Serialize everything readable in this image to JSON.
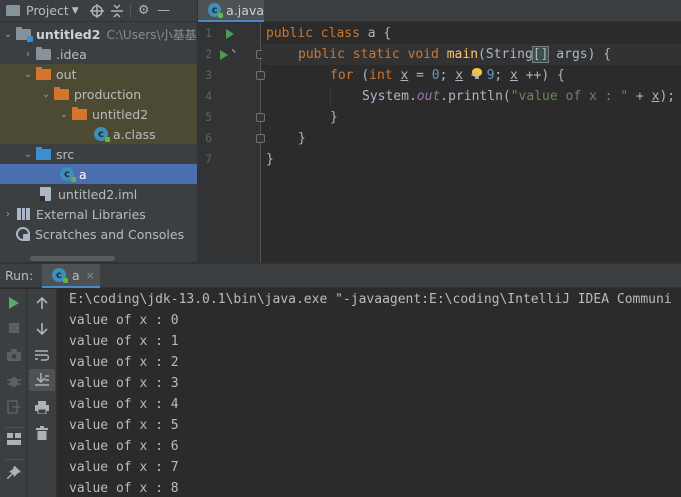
{
  "project": {
    "title": "Project",
    "toolbar_icons": [
      "crosshair-icon",
      "collapse-icon",
      "gear-icon",
      "minimize-icon"
    ],
    "tree": [
      {
        "label": "untitled2",
        "extra": "C:\\Users\\小基基",
        "icon": "module-folder-icon"
      },
      {
        "label": ".idea",
        "icon": "folder-icon"
      },
      {
        "label": "out",
        "icon": "folder-icon"
      },
      {
        "label": "production",
        "icon": "folder-icon"
      },
      {
        "label": "untitled2",
        "icon": "folder-icon"
      },
      {
        "label": "a.class",
        "icon": "class-icon"
      },
      {
        "label": "src",
        "icon": "source-folder-icon"
      },
      {
        "label": "a",
        "icon": "class-icon"
      },
      {
        "label": "untitled2.iml",
        "icon": "iml-file-icon"
      },
      {
        "label": "External Libraries",
        "icon": "libraries-icon"
      },
      {
        "label": "Scratches and Consoles",
        "icon": "scratches-icon"
      }
    ]
  },
  "editor": {
    "tab_label": "a.java",
    "line_numbers": [
      "1",
      "2",
      "3",
      "4",
      "5",
      "6",
      "7"
    ],
    "code": {
      "l1": {
        "kw": "public class ",
        "rest": "a {"
      },
      "l2": {
        "kw1": "public static void ",
        "fn": "main",
        "p1": "(String",
        "br": "[]",
        "p2": " args) {"
      },
      "l3": {
        "kw": "for ",
        "p1": "(",
        "kw2": "int ",
        "v1": "x",
        "p2": " = ",
        "n1": "0",
        "p3": "; ",
        "v2": "x",
        "p4": " < ",
        "n2": "9",
        "p5": "; ",
        "v3": "x",
        "p6": " ++) {"
      },
      "l4": {
        "p1": "System.",
        "st": "out",
        "p2": ".println(",
        "s": "\"value of x : \"",
        "p3": " + ",
        "v": "x",
        "p4": ");"
      },
      "l5": "}",
      "l6": "}",
      "l7": "}"
    }
  },
  "run": {
    "label": "Run:",
    "tab_label": "a",
    "command": "E:\\coding\\jdk-13.0.1\\bin\\java.exe \"-javaagent:E:\\coding\\IntelliJ IDEA Communi",
    "output": [
      "value of x : 0",
      "value of x : 1",
      "value of x : 2",
      "value of x : 3",
      "value of x : 4",
      "value of x : 5",
      "value of x : 6",
      "value of x : 7",
      "value of x : 8"
    ]
  },
  "colors": {
    "keyword": "#cc7832",
    "function": "#ffc66d",
    "number": "#6897bb",
    "string": "#6a8759",
    "static_field": "#9876aa",
    "selection": "#4b6eaf",
    "run_green": "#59a869"
  }
}
